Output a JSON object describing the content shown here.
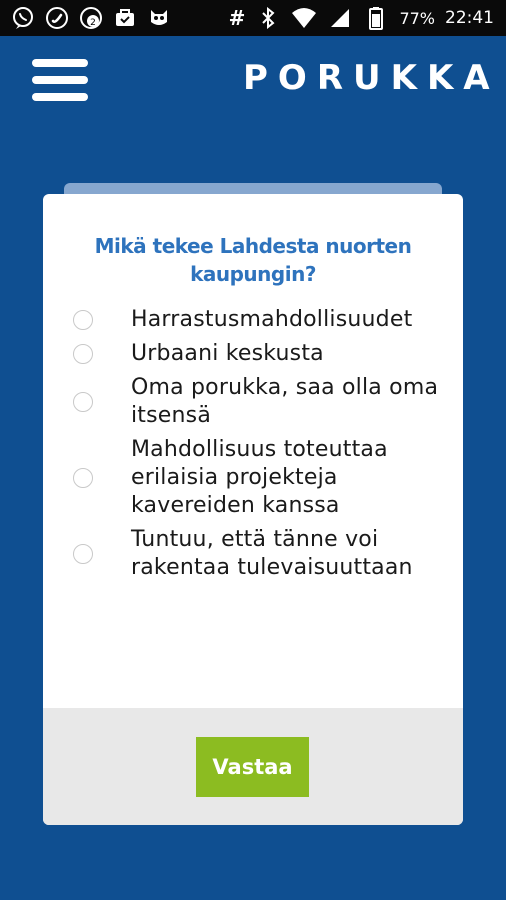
{
  "status_bar": {
    "left_icons": [
      "viber-icon",
      "phone-call-icon",
      "chat-badge-icon",
      "briefcase-icon",
      "owl-icon"
    ],
    "hash_symbol": "#",
    "battery_percent": "77%",
    "time": "22:41"
  },
  "header": {
    "logo_text": "PORUKKA"
  },
  "poll": {
    "question": "Mikä tekee Lahdesta nuorten kaupungin?",
    "options": [
      {
        "label": "Harrastusmahdollisuudet",
        "selected": false
      },
      {
        "label": "Urbaani keskusta",
        "selected": false
      },
      {
        "label": "Oma porukka, saa olla oma itsensä",
        "selected": false
      },
      {
        "label": "Mahdollisuus toteuttaa erilaisia projekteja kavereiden kanssa",
        "selected": false
      },
      {
        "label": "Tuntuu, että tänne voi rakentaa tulevaisuuttaan",
        "selected": false
      }
    ],
    "submit_label": "Vastaa"
  },
  "colors": {
    "background": "#0f4f91",
    "question_text": "#2e73bd",
    "submit_button": "#8cbc21",
    "footer": "#e8e8e8"
  }
}
